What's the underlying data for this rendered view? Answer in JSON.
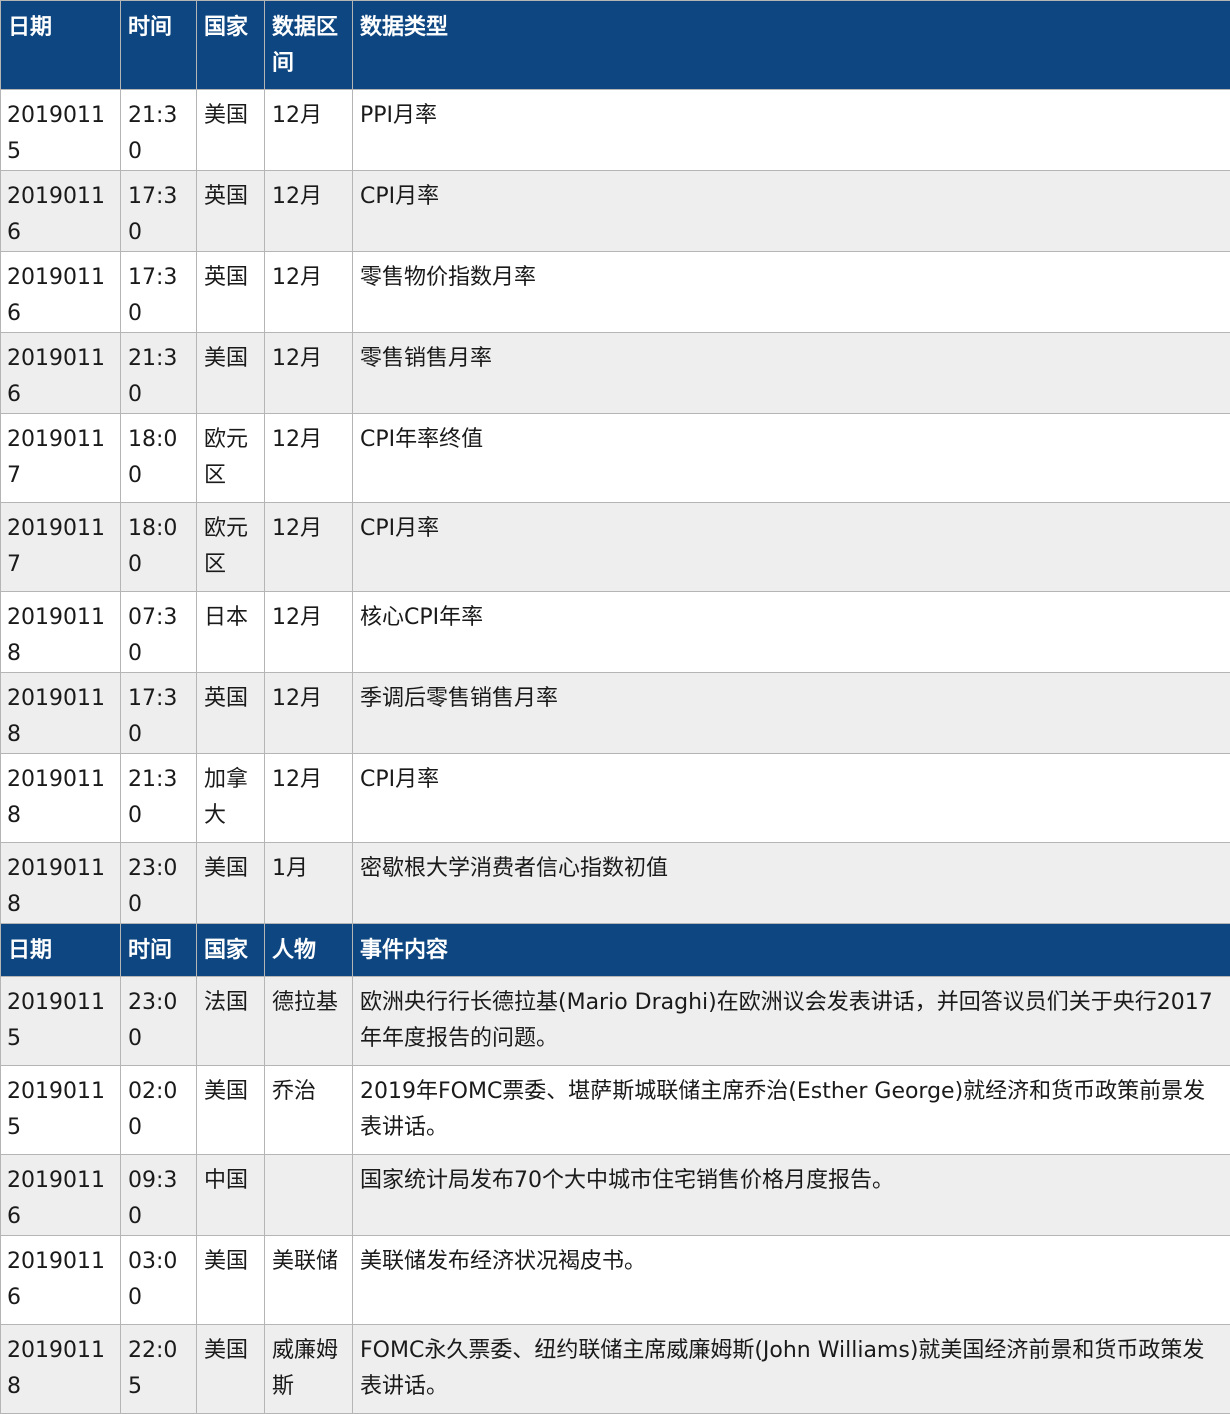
{
  "economic_header": [
    "日期",
    "时间",
    "国家",
    "数据区间",
    "数据类型"
  ],
  "economic_rows": [
    [
      "20190115",
      "21:30",
      "美国",
      "12月",
      "PPI月率"
    ],
    [
      "20190116",
      "17:30",
      "英国",
      "12月",
      "CPI月率"
    ],
    [
      "20190116",
      "17:30",
      "英国",
      "12月",
      "零售物价指数月率"
    ],
    [
      "20190116",
      "21:30",
      "美国",
      "12月",
      "零售销售月率"
    ],
    [
      "20190117",
      "18:00",
      "欧元区",
      "12月",
      "CPI年率终值"
    ],
    [
      "20190117",
      "18:00",
      "欧元区",
      "12月",
      "CPI月率"
    ],
    [
      "20190118",
      "07:30",
      "日本",
      "12月",
      "核心CPI年率"
    ],
    [
      "20190118",
      "17:30",
      "英国",
      "12月",
      "季调后零售销售月率"
    ],
    [
      "20190118",
      "21:30",
      "加拿大",
      "12月",
      "CPI月率"
    ],
    [
      "20190118",
      "23:00",
      "美国",
      "1月",
      "密歇根大学消费者信心指数初值"
    ]
  ],
  "event_header": [
    "日期",
    "时间",
    "国家",
    "人物",
    "事件内容"
  ],
  "event_rows": [
    [
      "20190115",
      "23:00",
      "法国",
      "德拉基",
      "欧洲央行行长德拉基(Mario Draghi)在欧洲议会发表讲话，并回答议员们关于央行2017年年度报告的问题。"
    ],
    [
      "20190115",
      "02:00",
      "美国",
      "乔治",
      "2019年FOMC票委、堪萨斯城联储主席乔治(Esther George)就经济和货币政策前景发表讲话。"
    ],
    [
      "20190116",
      "09:30",
      "中国",
      "",
      "国家统计局发布70个大中城市住宅销售价格月度报告。"
    ],
    [
      "20190116",
      "03:00",
      "美国",
      "美联储",
      "美联储发布经济状况褐皮书。"
    ],
    [
      "20190118",
      "22:05",
      "美国",
      "威廉姆斯",
      "FOMC永久票委、纽约联储主席威廉姆斯(John Williams)就美国经济前景和货币政策发表讲话。"
    ]
  ]
}
